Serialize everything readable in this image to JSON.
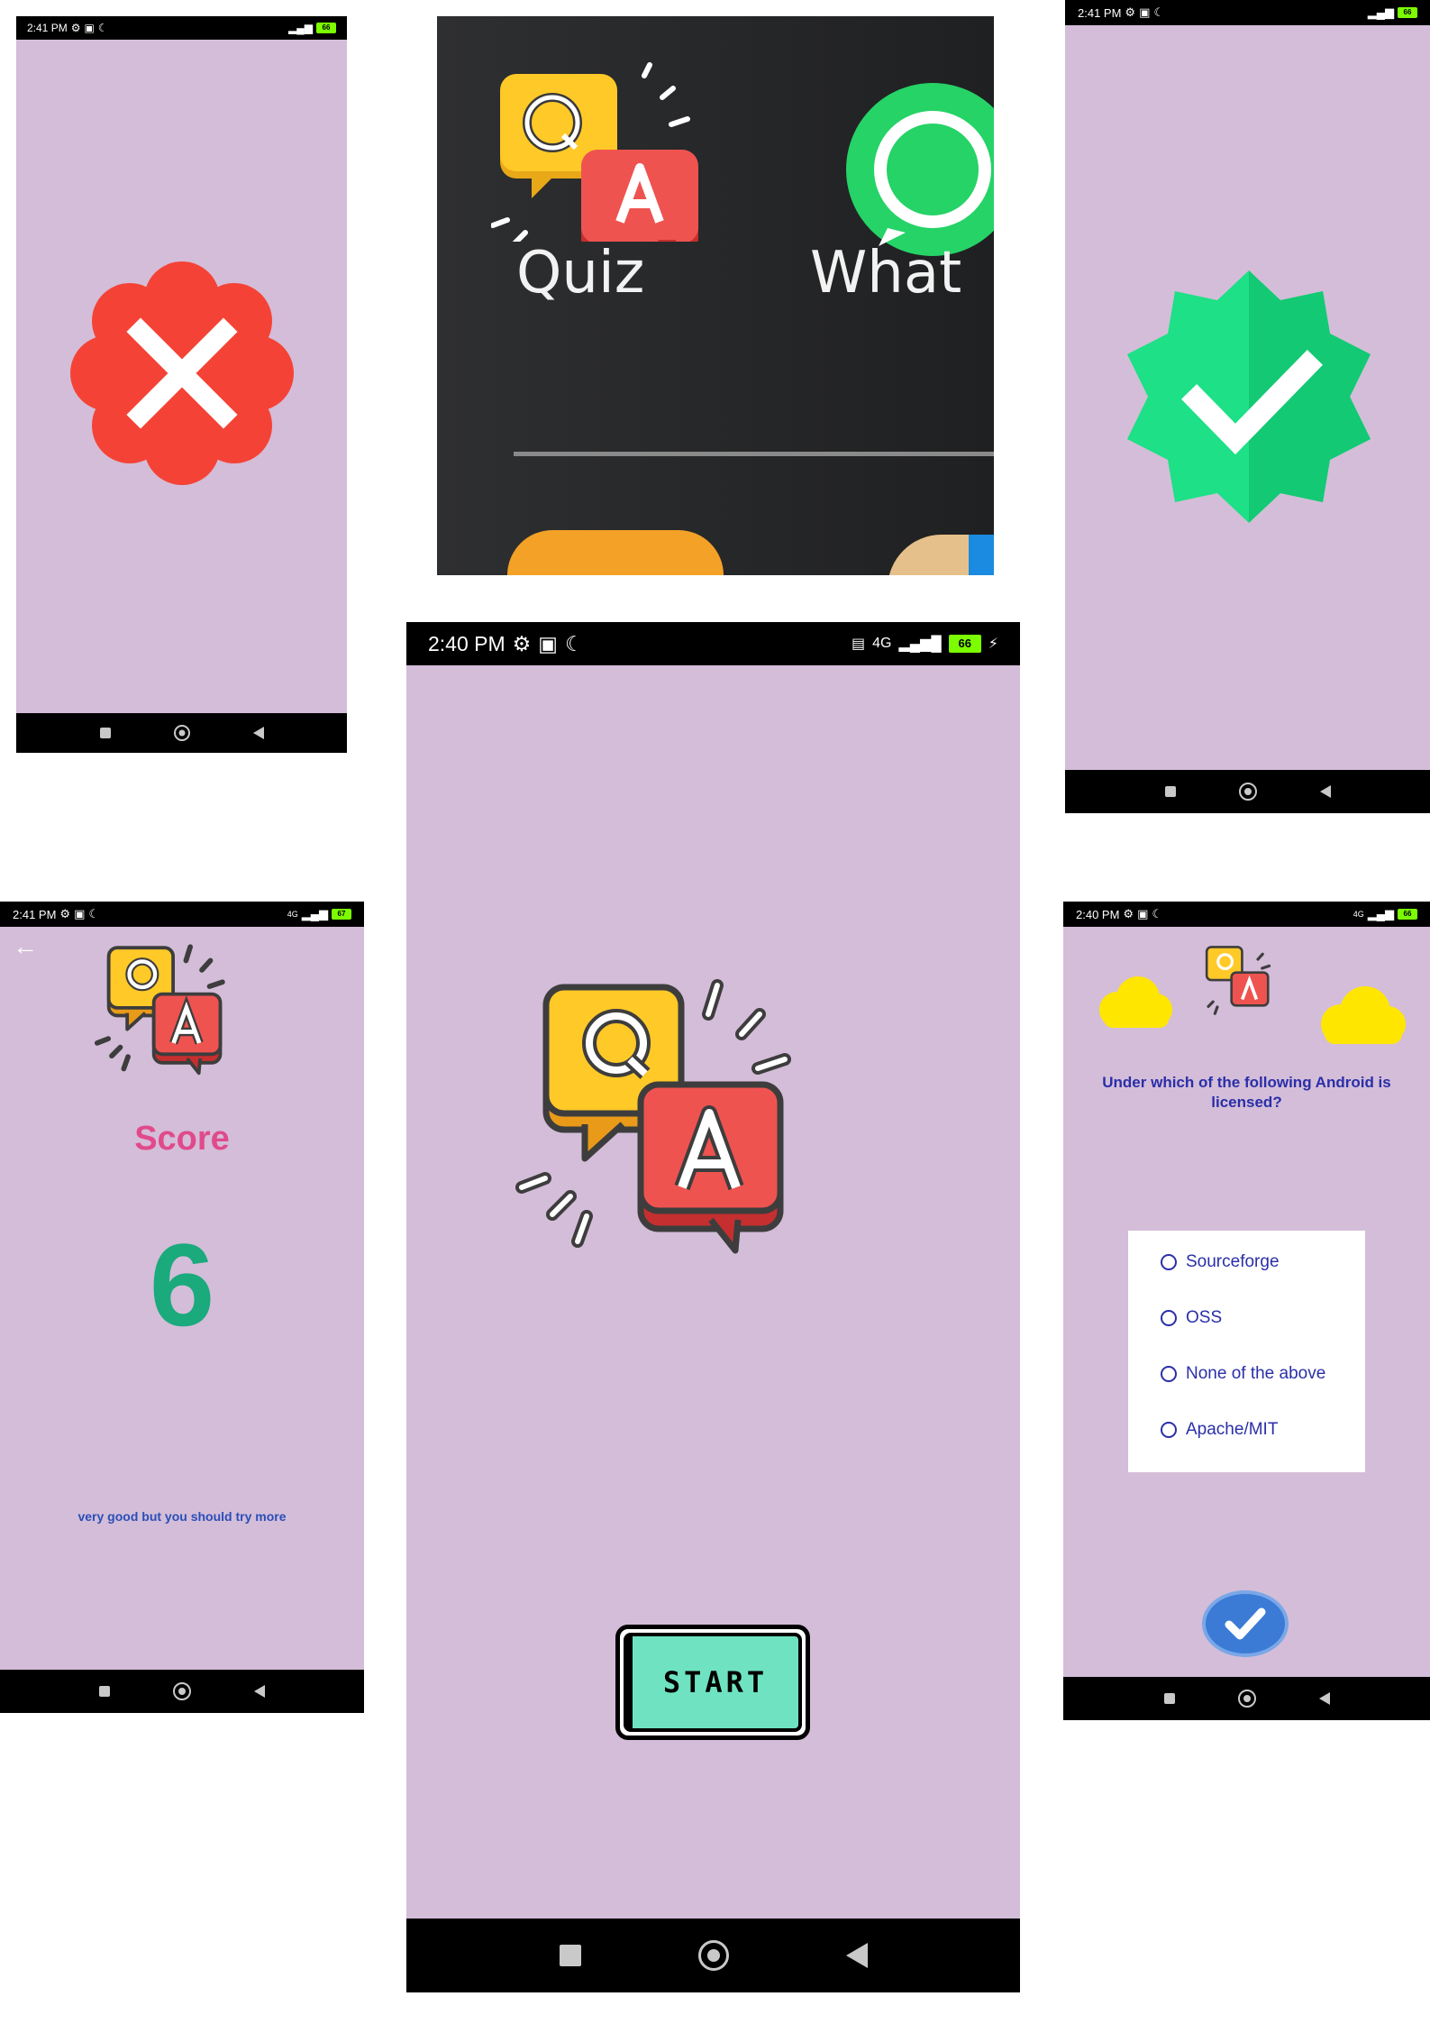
{
  "screen_wrong": {
    "status": {
      "time": "2:41 PM",
      "battery": "66"
    },
    "icon": "wrong-answer-x-icon",
    "accent": "#f44336"
  },
  "launcher": {
    "apps": [
      {
        "label": "Quiz",
        "icon": "quiz-qa-icon"
      },
      {
        "label": "What",
        "icon": "whatsapp-icon"
      }
    ]
  },
  "screen_correct": {
    "status": {
      "time": "2:41 PM",
      "battery": "66"
    },
    "icon": "correct-answer-check-icon",
    "accent": "#14d17a"
  },
  "screen_splash": {
    "status": {
      "time": "2:40 PM",
      "network": "4G",
      "battery": "66"
    },
    "logo": "quiz-qa-logo",
    "start_label": "START",
    "start_color": "#6fe3c1"
  },
  "screen_score": {
    "status": {
      "time": "2:41 PM",
      "network": "4G",
      "battery": "67"
    },
    "title": "Score",
    "score": "6",
    "message": "very good but you should try more",
    "title_color": "#e04a8b",
    "score_color": "#1aaa7c"
  },
  "screen_question": {
    "status": {
      "time": "2:40 PM",
      "network": "4G",
      "battery": "66"
    },
    "question": "Under which of the following Android is licensed?",
    "options": [
      "Sourceforge",
      "OSS",
      "None of the above",
      "Apache/MIT"
    ],
    "submit_icon": "check-submit-icon"
  }
}
